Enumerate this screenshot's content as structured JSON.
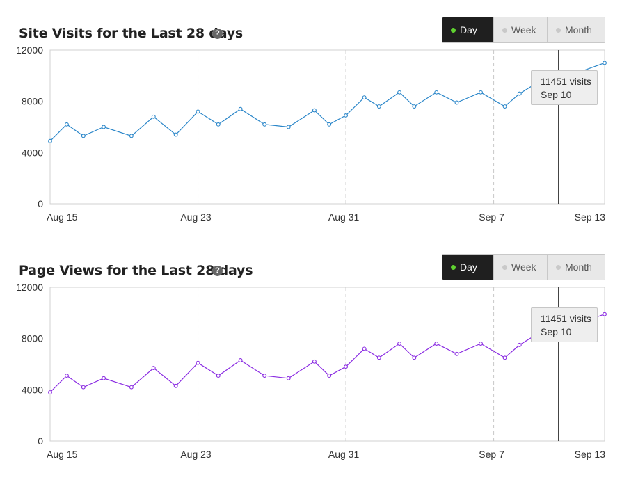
{
  "charts": [
    {
      "title": "Site Visits for the Last 28 days",
      "help_icon": "?",
      "color": "#2a86c9",
      "buttons": [
        {
          "label": "Day",
          "active": true
        },
        {
          "label": "Week",
          "active": false
        },
        {
          "label": "Month",
          "active": false
        }
      ],
      "tooltip": {
        "value": "11451 visits",
        "date": "Sep 10"
      }
    },
    {
      "title": "Page Views for the Last 28 days",
      "help_icon": "?",
      "color": "#8a2be2",
      "buttons": [
        {
          "label": "Day",
          "active": true
        },
        {
          "label": "Week",
          "active": false
        },
        {
          "label": "Month",
          "active": false
        }
      ],
      "tooltip": {
        "value": "11451 visits",
        "date": "Sep 10"
      }
    }
  ],
  "chart_data": [
    {
      "type": "line",
      "title": "Site Visits for the Last 28 days",
      "ylim": [
        0,
        12000
      ],
      "y_ticks": [
        "12000",
        "8000",
        "4000",
        "0"
      ],
      "x_ticks": [
        "Aug 15",
        "Aug 23",
        "Aug 31",
        "Sep 7",
        "Sep 13"
      ],
      "x_tick_days": [
        0,
        8,
        16,
        24,
        30
      ],
      "highlight_day": 27.5,
      "x": [
        0,
        0.9,
        1.8,
        2.9,
        4.4,
        5.6,
        6.8,
        8,
        9.1,
        10.3,
        11.6,
        12.9,
        14.3,
        15.1,
        16,
        17,
        17.8,
        18.9,
        19.7,
        20.9,
        22,
        23.3,
        24.6,
        25.4,
        26.3,
        27.5,
        30
      ],
      "series": [
        {
          "values": [
            4900,
            6200,
            5300,
            6000,
            5300,
            6800,
            5400,
            7200,
            6200,
            7400,
            6200,
            6000,
            7300,
            6200,
            6900,
            8300,
            7600,
            8700,
            7600,
            8700,
            7900,
            8700,
            7600,
            8600,
            9400,
            9700,
            11000
          ]
        }
      ]
    },
    {
      "type": "line",
      "title": "Page Views for the Last 28 days",
      "ylim": [
        0,
        12000
      ],
      "y_ticks": [
        "12000",
        "8000",
        "4000",
        "0"
      ],
      "x_ticks": [
        "Aug 15",
        "Aug 23",
        "Aug 31",
        "Sep 7",
        "Sep 13"
      ],
      "x_tick_days": [
        0,
        8,
        16,
        24,
        30
      ],
      "highlight_day": 27.5,
      "x": [
        0,
        0.9,
        1.8,
        2.9,
        4.4,
        5.6,
        6.8,
        8,
        9.1,
        10.3,
        11.6,
        12.9,
        14.3,
        15.1,
        16,
        17,
        17.8,
        18.9,
        19.7,
        20.9,
        22,
        23.3,
        24.6,
        25.4,
        26.3,
        27.5,
        30
      ],
      "series": [
        {
          "values": [
            3800,
            5100,
            4200,
            4900,
            4200,
            5700,
            4300,
            6100,
            5100,
            6300,
            5100,
            4900,
            6200,
            5100,
            5800,
            7200,
            6500,
            7600,
            6500,
            7600,
            6800,
            7600,
            6500,
            7500,
            8300,
            8600,
            9900
          ]
        }
      ]
    }
  ]
}
